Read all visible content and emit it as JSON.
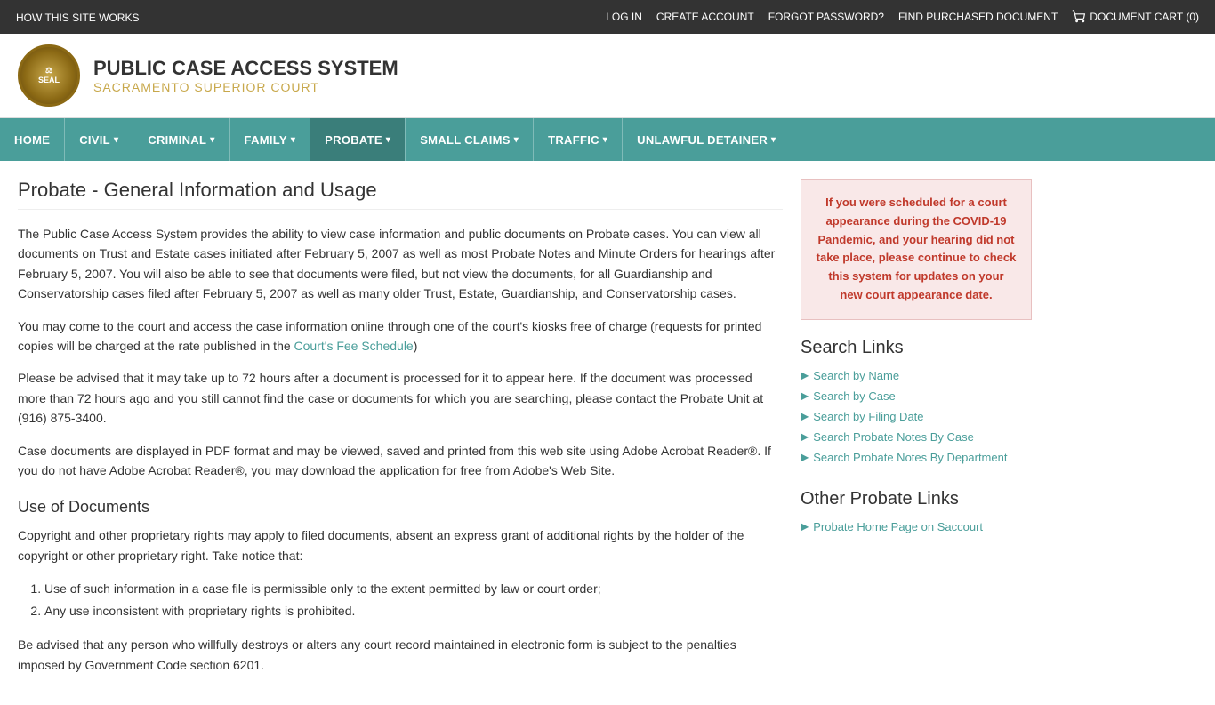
{
  "topbar": {
    "left": {
      "label": "HOW THIS SITE WORKS"
    },
    "right": {
      "links": [
        {
          "id": "login",
          "label": "LOG IN"
        },
        {
          "id": "create-account",
          "label": "CREATE ACCOUNT"
        },
        {
          "id": "forgot-password",
          "label": "FORGOT PASSWORD?"
        },
        {
          "id": "find-purchased",
          "label": "FIND PURCHASED DOCUMENT"
        },
        {
          "id": "document-cart",
          "label": "DOCUMENT CART (0)"
        }
      ]
    }
  },
  "header": {
    "title": "PUBLIC CASE ACCESS SYSTEM",
    "subtitle": "SACRAMENTO SUPERIOR COURT"
  },
  "nav": {
    "items": [
      {
        "id": "home",
        "label": "HOME",
        "hasDropdown": false
      },
      {
        "id": "civil",
        "label": "CIVIL",
        "hasDropdown": true
      },
      {
        "id": "criminal",
        "label": "CRIMINAL",
        "hasDropdown": true
      },
      {
        "id": "family",
        "label": "FAMILY",
        "hasDropdown": true
      },
      {
        "id": "probate",
        "label": "PROBATE",
        "hasDropdown": true,
        "active": true
      },
      {
        "id": "small-claims",
        "label": "SMALL CLAIMS",
        "hasDropdown": true
      },
      {
        "id": "traffic",
        "label": "TRAFFIC",
        "hasDropdown": true
      },
      {
        "id": "unlawful-detainer",
        "label": "UNLAWFUL DETAINER",
        "hasDropdown": true
      }
    ]
  },
  "content": {
    "page_title": "Probate - General Information and Usage",
    "paragraphs": [
      "The Public Case Access System provides the ability to view case information and public documents on Probate cases. You can view all documents on Trust and Estate cases initiated after February 5, 2007 as well as most Probate Notes and Minute Orders for hearings after February 5, 2007. You will also be able to see that documents were filed, but not view the documents, for all Guardianship and Conservatorship cases filed after February 5, 2007 as well as many older Trust, Estate, Guardianship, and Conservatorship cases.",
      "You may come to the court and access the case information online through one of the court's kiosks free of charge (requests for printed copies will be charged at the rate published in the",
      "Please be advised that it may take up to 72 hours after a document is processed for it to appear here. If the document was processed more than 72 hours ago and you still cannot find the case or documents for which you are searching, please contact the Probate Unit at (916) 875-3400.",
      "Case documents are displayed in PDF format and may be viewed, saved and printed from this web site using Adobe Acrobat Reader®. If you do not have Adobe Acrobat Reader®, you may download the application for free from Adobe's Web Site."
    ],
    "fee_schedule_text": "Court's Fee Schedule",
    "para2_suffix": ")",
    "section_title": "Use of Documents",
    "section_para": "Copyright and other proprietary rights may apply to filed documents, absent an express grant of additional rights by the holder of the copyright or other proprietary right. Take notice that:",
    "list_items": [
      "Use of such information in a case file is permissible only to the extent permitted by law or court order;",
      "Any use inconsistent with proprietary rights is prohibited."
    ],
    "final_para": "Be advised that any person who willfully destroys or alters any court record maintained in electronic form is subject to the penalties imposed by Government Code section 6201."
  },
  "sidebar": {
    "notice": "If you were scheduled for a court appearance during the COVID-19 Pandemic, and your hearing did not take place, please continue to check this system for updates on your new court appearance date.",
    "search_links_title": "Search Links",
    "search_links": [
      {
        "id": "search-by-name",
        "label": "Search by Name"
      },
      {
        "id": "search-by-case",
        "label": "Search by Case"
      },
      {
        "id": "search-by-filing-date",
        "label": "Search by Filing Date"
      },
      {
        "id": "search-probate-notes-case",
        "label": "Search Probate Notes By Case"
      },
      {
        "id": "search-probate-notes-dept",
        "label": "Search Probate Notes By Department"
      }
    ],
    "other_links_title": "Other Probate Links",
    "other_links": [
      {
        "id": "probate-home",
        "label": "Probate Home Page on Saccourt"
      }
    ]
  },
  "colors": {
    "teal": "#4a9e9a",
    "dark": "#333",
    "accent_gold": "#c8a84b",
    "red_notice": "#c0392b",
    "red_notice_bg": "#f9e8e8"
  }
}
